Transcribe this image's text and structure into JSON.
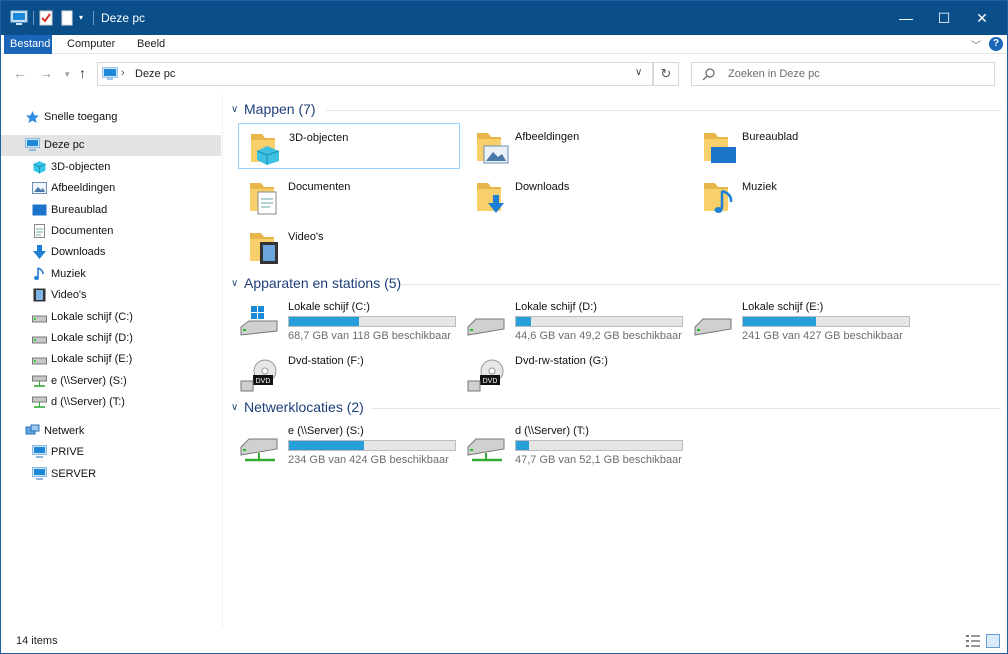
{
  "window": {
    "title": "Deze pc",
    "controls": {
      "minimize": "—",
      "maximize": "☐",
      "close": "✕"
    }
  },
  "ribbon": {
    "tabs": [
      {
        "label": "Bestand",
        "active": true
      },
      {
        "label": "Computer",
        "active": false
      },
      {
        "label": "Beeld",
        "active": false
      }
    ],
    "help": "?"
  },
  "address": {
    "path": "Deze pc",
    "search_placeholder": "Zoeken in Deze pc"
  },
  "sidebar": {
    "items": [
      {
        "label": "Snelle toegang",
        "icon": "star-icon"
      },
      {
        "label": "Deze pc",
        "icon": "computer-icon",
        "selected": true
      },
      {
        "label": "3D-objecten",
        "icon": "cube-icon"
      },
      {
        "label": "Afbeeldingen",
        "icon": "pictures-icon"
      },
      {
        "label": "Bureaublad",
        "icon": "desktop-icon"
      },
      {
        "label": "Documenten",
        "icon": "document-icon"
      },
      {
        "label": "Downloads",
        "icon": "download-icon"
      },
      {
        "label": "Muziek",
        "icon": "music-icon"
      },
      {
        "label": "Video's",
        "icon": "video-icon"
      },
      {
        "label": "Lokale schijf (C:)",
        "icon": "drive-icon"
      },
      {
        "label": "Lokale schijf (D:)",
        "icon": "drive-icon"
      },
      {
        "label": "Lokale schijf (E:)",
        "icon": "drive-icon"
      },
      {
        "label": "e (\\\\Server) (S:)",
        "icon": "network-drive-icon"
      },
      {
        "label": "d (\\\\Server) (T:)",
        "icon": "network-drive-icon"
      },
      {
        "label": "Netwerk",
        "icon": "network-icon"
      },
      {
        "label": "PRIVE",
        "icon": "monitor-icon"
      },
      {
        "label": "SERVER",
        "icon": "monitor-icon"
      }
    ]
  },
  "groups": {
    "folders": {
      "title": "Mappen (7)",
      "items": [
        {
          "label": "3D-objecten",
          "icon": "folder-3d-icon"
        },
        {
          "label": "Afbeeldingen",
          "icon": "folder-pictures-icon"
        },
        {
          "label": "Bureaublad",
          "icon": "folder-desktop-icon"
        },
        {
          "label": "Documenten",
          "icon": "folder-documents-icon"
        },
        {
          "label": "Downloads",
          "icon": "folder-downloads-icon"
        },
        {
          "label": "Muziek",
          "icon": "folder-music-icon"
        },
        {
          "label": "Video's",
          "icon": "folder-videos-icon"
        }
      ]
    },
    "devices": {
      "title": "Apparaten en stations (5)",
      "items": [
        {
          "name": "Lokale schijf (C:)",
          "size": "68,7 GB van 118 GB beschikbaar",
          "used_fraction": 0.42,
          "icon": "windows-drive-icon"
        },
        {
          "name": "Lokale schijf (D:)",
          "size": "44,6 GB van 49,2 GB beschikbaar",
          "used_fraction": 0.09,
          "icon": "hdd-icon"
        },
        {
          "name": "Lokale schijf (E:)",
          "size": "241 GB van 427 GB beschikbaar",
          "used_fraction": 0.44,
          "icon": "hdd-icon"
        },
        {
          "name": "Dvd-station (F:)",
          "icon": "dvd-drive-icon",
          "dvd": "DVD"
        },
        {
          "name": "Dvd-rw-station (G:)",
          "icon": "dvd-drive-icon",
          "dvd": "DVD"
        }
      ]
    },
    "network": {
      "title": "Netwerklocaties (2)",
      "items": [
        {
          "name": "e (\\\\Server) (S:)",
          "size": "234 GB van 424 GB beschikbaar",
          "used_fraction": 0.45,
          "icon": "network-drive-icon"
        },
        {
          "name": "d (\\\\Server) (T:)",
          "size": "47,7 GB van 52,1 GB beschikbaar",
          "used_fraction": 0.08,
          "icon": "network-drive-icon"
        }
      ]
    }
  },
  "status": {
    "count": "14 items"
  },
  "colors": {
    "titlebar": "#0b4f8a",
    "accent": "#1a65b8",
    "bar_fill": "#26a0da",
    "group_title": "#1e3f7a"
  }
}
